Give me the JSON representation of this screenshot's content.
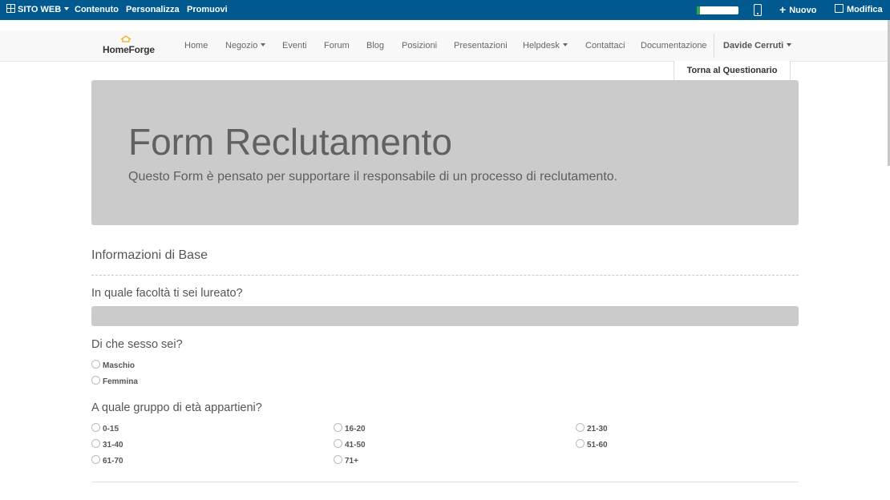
{
  "adminbar": {
    "site_menu": "SITO WEB",
    "contenuto": "Contenuto",
    "personalizza": "Personalizza",
    "promuovi": "Promuovi",
    "nuovo": "Nuovo",
    "modifica": "Modifica",
    "bg_color": "#00598f"
  },
  "navbar": {
    "logo_text": "HomeForge",
    "items": [
      {
        "label": "Home"
      },
      {
        "label": "Negozio"
      },
      {
        "label": "Eventi"
      },
      {
        "label": "Forum"
      },
      {
        "label": "Blog"
      },
      {
        "label": "Posizioni"
      },
      {
        "label": "Presentazioni"
      },
      {
        "label": "Helpdesk"
      },
      {
        "label": "Contattaci"
      },
      {
        "label": "Documentazione"
      }
    ],
    "user": "Davide Cerruti"
  },
  "back_button": "Torna al Questionario",
  "hero": {
    "title": "Form Reclutamento",
    "subtitle": "Questo Form è pensato per supportare il responsabile di un processo di reclutamento."
  },
  "section": {
    "title": "Informazioni di Base"
  },
  "questions": {
    "q1": {
      "label": "In quale facoltà ti sei lureato?",
      "value": ""
    },
    "q2": {
      "label": "Di che sesso sei?",
      "options": [
        "Maschio",
        "Femmina"
      ]
    },
    "q3": {
      "label": "A quale gruppo di età appartieni?",
      "options": [
        "0-15",
        "16-20",
        "21-30",
        "31-40",
        "41-50",
        "51-60",
        "61-70",
        "71+"
      ]
    }
  }
}
